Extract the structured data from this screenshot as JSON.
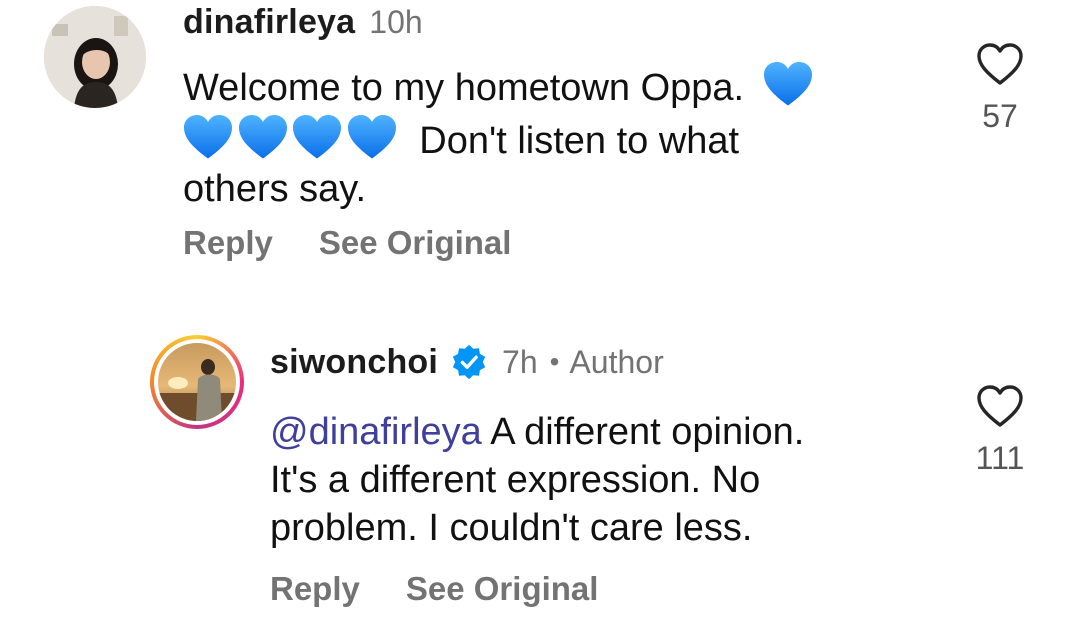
{
  "comments": [
    {
      "username": "dinafirleya",
      "time": "10h",
      "text_line1": "Welcome to my hometown Oppa.",
      "text_line2": "Don't listen to what",
      "text_line3": "others say.",
      "hearts_line1": 1,
      "hearts_line2": 4,
      "reply_label": "Reply",
      "see_original_label": "See Original",
      "like_count": "57"
    },
    {
      "username": "siwonchoi",
      "verified": true,
      "time": "7h",
      "separator": "•",
      "author_label": "Author",
      "mention": "@dinafirleya",
      "text_line1": " A different opinion.",
      "text_line2": "It's a different expression. No",
      "text_line3": "problem. I couldn't care less.",
      "reply_label": "Reply",
      "see_original_label": "See Original",
      "like_count": "111"
    }
  ],
  "colors": {
    "heart_emoji": "#1a8cff",
    "verified_badge": "#0095f6",
    "mention": "#3f3f9c",
    "muted": "#737373",
    "story_ring_start": "#f9ce34",
    "story_ring_end": "#c13584"
  },
  "icons": {
    "like": "heart-outline-icon",
    "verified": "verified-badge-icon",
    "emoji": "blue-heart-emoji-icon"
  }
}
